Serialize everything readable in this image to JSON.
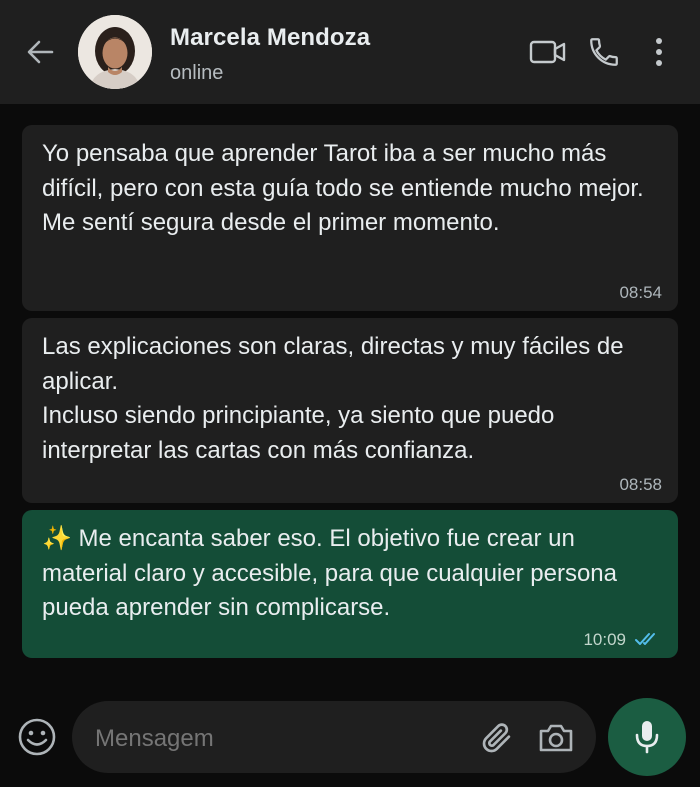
{
  "header": {
    "back_icon": "arrow-left-icon",
    "contact_name": "Marcela Mendoza",
    "status": "online",
    "video_icon": "video-camera-icon",
    "call_icon": "phone-icon",
    "more_icon": "more-vertical-icon"
  },
  "messages": [
    {
      "direction": "incoming",
      "text": "Yo pensaba que aprender Tarot iba a ser mucho más difícil, pero con esta guía todo se entiende mucho mejor.\nMe sentí segura desde el primer momento.",
      "time": "08:54"
    },
    {
      "direction": "incoming",
      "text": "Las explicaciones son claras, directas y muy fáciles de aplicar.\nIncluso siendo principiante, ya siento que puedo interpretar las cartas con más confianza.",
      "time": "08:58"
    },
    {
      "direction": "outgoing",
      "text": "✨ Me encanta saber eso. El objetivo fue crear un material claro y accesible, para que cualquier persona pueda aprender sin complicarse.",
      "time": "10:09",
      "status": "read"
    }
  ],
  "composer": {
    "placeholder": "Mensagem",
    "emoji_icon": "emoji-icon",
    "attach_icon": "paperclip-icon",
    "camera_icon": "camera-icon",
    "mic_icon": "microphone-icon"
  },
  "colors": {
    "header_bg": "#1f1f1f",
    "chat_bg": "#0b0b0b",
    "incoming_bubble": "#1f1f1f",
    "outgoing_bubble": "#144d37",
    "read_ticks": "#53bdeb",
    "mic_button": "#1b5d42"
  }
}
